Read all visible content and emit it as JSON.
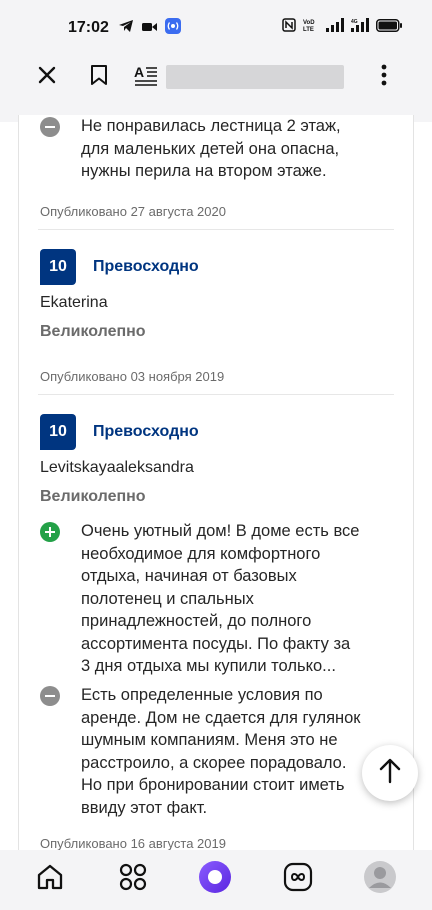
{
  "status_bar": {
    "time": "17:02",
    "battery_color": "#111111"
  },
  "toolbar": {
    "close_icon": "close-icon",
    "bookmark_icon": "bookmark-icon",
    "reader_icon": "reader-mode-icon",
    "menu_icon": "more-vertical-icon"
  },
  "reviews": {
    "prev_con_text": "Не понравилась лестница 2 этаж,\nдля маленьких детей она опасна,\nнужны перила на втором этаже.",
    "prev_published": "Опубликовано 27 августа 2020",
    "items": [
      {
        "score": "10",
        "score_label": "Превосходно",
        "reviewer": "Ekaterina",
        "title": "Великолепно",
        "published": "Опубликовано 03 ноября 2019"
      },
      {
        "score": "10",
        "score_label": "Превосходно",
        "reviewer": "Levitskayaaleksandra",
        "title": "Великолепно",
        "pro_text": "Очень уютный дом! В доме есть все\nнеобходимое для комфортного\nотдыха, начиная от базовых\nполотенец и спальных\nпринадлежностей, до полного\nассортимента посуды. По факту за\n3 дня отдыха мы купили только...",
        "con_text": "Есть определенные условия по\nаренде. Дом не сдается для гулянок\nшумным компаниям. Меня это не\nрасстроило, а скорее порадовало.\nНо при бронировании стоит иметь\nввиду этот факт.",
        "published": "Опубликовано 16 августа 2019"
      }
    ]
  },
  "colors": {
    "brand": "#003580",
    "pro": "#24a148",
    "con": "#8d8d8d",
    "alice": "#6f3cf0"
  },
  "bottom_nav": [
    "home-icon",
    "apps-grid-icon",
    "alice-assistant-icon",
    "infinity-icon",
    "profile-avatar-icon"
  ]
}
